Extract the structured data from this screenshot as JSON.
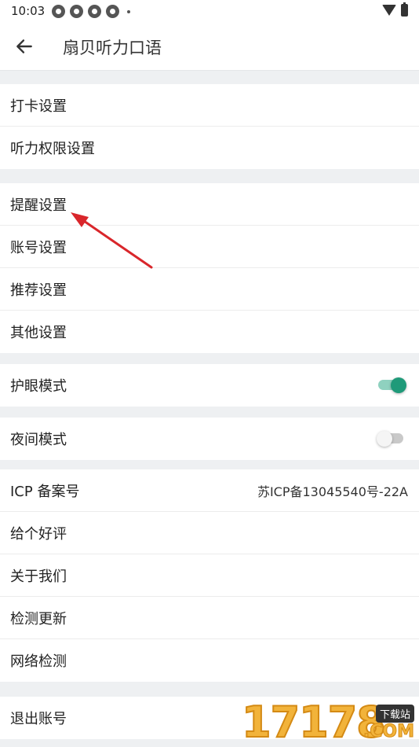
{
  "status_bar": {
    "time": "10:03",
    "left_icons": [
      "notification-icon",
      "notification-icon",
      "notification-icon",
      "notification-icon"
    ],
    "right_icons": [
      "wifi-icon",
      "battery-icon"
    ]
  },
  "app_bar": {
    "title": "扇贝听力口语"
  },
  "groups": {
    "g1": [
      {
        "label": "打卡设置"
      },
      {
        "label": "听力权限设置"
      }
    ],
    "g2": [
      {
        "label": "提醒设置"
      },
      {
        "label": "账号设置"
      },
      {
        "label": "推荐设置"
      },
      {
        "label": "其他设置"
      }
    ],
    "eye_mode": {
      "label": "护眼模式",
      "enabled": true
    },
    "night_mode": {
      "label": "夜间模式",
      "enabled": false
    },
    "g5": [
      {
        "label": "ICP 备案号",
        "value": "苏ICP备13045540号-22A"
      },
      {
        "label": "给个好评"
      },
      {
        "label": "关于我们"
      },
      {
        "label": "检测更新"
      },
      {
        "label": "网络检测"
      }
    ],
    "logout": {
      "label": "退出账号"
    }
  },
  "colors": {
    "toggle_on": "#1f9a79",
    "annotation_arrow": "#d9262b",
    "watermark": "#f2b33a"
  },
  "watermark": {
    "digits": "17178",
    "tag": "下载站",
    "suffix": ".COM"
  }
}
